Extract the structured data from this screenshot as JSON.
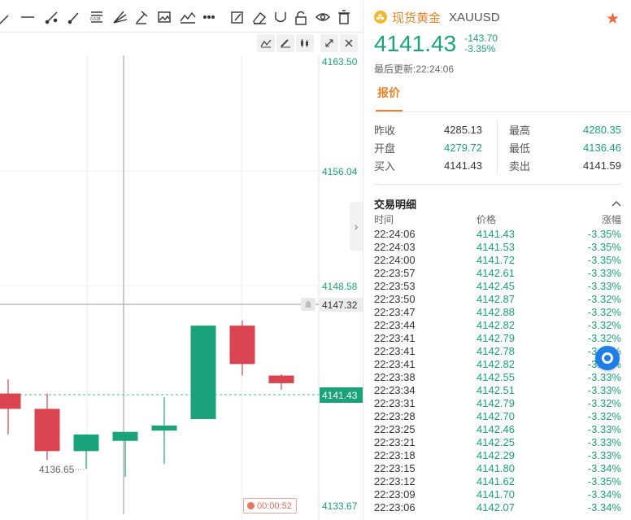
{
  "instrument": {
    "name": "现货黄金",
    "code": "XAUUSD",
    "last_price": "4141.43",
    "change": "-143.70",
    "change_pct": "-3.35%",
    "updated": "最后更新:22:24:06"
  },
  "tabs": {
    "quote": "报价"
  },
  "stats": {
    "prev_close_label": "昨收",
    "prev_close": "4285.13",
    "open_label": "开盘",
    "open": "4279.72",
    "buy_label": "买入",
    "buy": "4141.43",
    "high_label": "最高",
    "high": "4280.35",
    "low_label": "最低",
    "low": "4136.46",
    "sell_label": "卖出",
    "sell": "4141.59"
  },
  "trades": {
    "title": "交易明细",
    "col_time": "时间",
    "col_price": "价格",
    "col_change": "涨幅",
    "rows": [
      [
        "22:24:06",
        "4141.43",
        "-3.35%"
      ],
      [
        "22:24:03",
        "4141.53",
        "-3.35%"
      ],
      [
        "22:24:00",
        "4141.72",
        "-3.35%"
      ],
      [
        "22:23:57",
        "4142.61",
        "-3.33%"
      ],
      [
        "22:23:53",
        "4142.45",
        "-3.33%"
      ],
      [
        "22:23:50",
        "4142.87",
        "-3.32%"
      ],
      [
        "22:23:47",
        "4142.88",
        "-3.32%"
      ],
      [
        "22:23:44",
        "4142.82",
        "-3.32%"
      ],
      [
        "22:23:41",
        "4142.79",
        "-3.32%"
      ],
      [
        "22:23:41",
        "4142.78",
        "-3.32%"
      ],
      [
        "22:23:41",
        "4142.82",
        "-3.32%"
      ],
      [
        "22:23:38",
        "4142.55",
        "-3.33%"
      ],
      [
        "22:23:34",
        "4142.51",
        "-3.33%"
      ],
      [
        "22:23:31",
        "4142.79",
        "-3.32%"
      ],
      [
        "22:23:28",
        "4142.70",
        "-3.32%"
      ],
      [
        "22:23:25",
        "4142.46",
        "-3.33%"
      ],
      [
        "22:23:21",
        "4142.25",
        "-3.33%"
      ],
      [
        "22:23:18",
        "4142.29",
        "-3.33%"
      ],
      [
        "22:23:15",
        "4141.80",
        "-3.34%"
      ],
      [
        "22:23:12",
        "4141.62",
        "-3.35%"
      ],
      [
        "22:23:09",
        "4141.70",
        "-3.34%"
      ],
      [
        "22:23:06",
        "4142.07",
        "-3.34%"
      ]
    ]
  },
  "chart": {
    "price_labels": [
      "4163.50",
      "4156.04",
      "4148.58",
      "4133.67"
    ],
    "crosshair_price": "4147.32",
    "last_price_tag": "4141.43",
    "low_annotation": "4136.65",
    "countdown": "00:00:52",
    "colors": {
      "up": "#1aa37a",
      "down": "#d94450",
      "accent": "#e8852a"
    }
  },
  "chart_data": {
    "type": "candlestick",
    "ylim": [
      4131.8,
      4166.5
    ],
    "candles": [
      {
        "o": 4140.6,
        "h": 4141.7,
        "l": 4137.4,
        "c": 4139.4
      },
      {
        "o": 4139.4,
        "h": 4140.6,
        "l": 4135.4,
        "c": 4136.1
      },
      {
        "o": 4136.1,
        "h": 4137.4,
        "l": 4134.7,
        "c": 4137.4
      },
      {
        "o": 4136.9,
        "h": 4137.6,
        "l": 4134.1,
        "c": 4137.6
      },
      {
        "o": 4137.7,
        "h": 4140.3,
        "l": 4135.1,
        "c": 4138.1
      },
      {
        "o": 4138.6,
        "h": 4145.9,
        "l": 4138.6,
        "c": 4145.9
      },
      {
        "o": 4145.9,
        "h": 4146.3,
        "l": 4142.0,
        "c": 4142.9
      },
      {
        "o": 4142.0,
        "h": 4142.1,
        "l": 4140.9,
        "c": 4141.4
      }
    ]
  }
}
